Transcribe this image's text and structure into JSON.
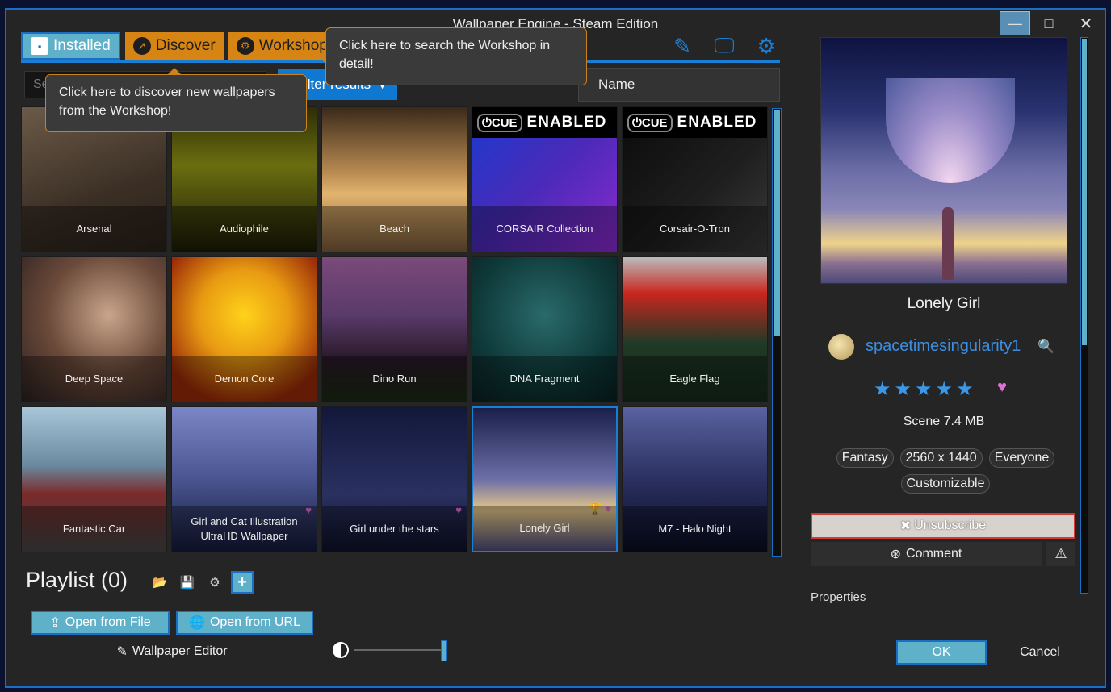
{
  "window": {
    "title": "Wallpaper Engine - Steam Edition",
    "controls": {
      "minimize": "—",
      "maximize": "□",
      "close": "✕"
    }
  },
  "tabs": [
    {
      "label": "Installed",
      "icon": "floppy-disk-icon",
      "glyph": "▪"
    },
    {
      "label": "Discover",
      "icon": "compass-icon",
      "glyph": "➚"
    },
    {
      "label": "Workshop",
      "icon": "steam-icon",
      "glyph": "⚙"
    }
  ],
  "toolbar_icons": [
    {
      "name": "editor-tools-icon",
      "glyph": "✎"
    },
    {
      "name": "display-icon",
      "glyph": "🖵"
    },
    {
      "name": "settings-gear-icon",
      "glyph": "⚙"
    }
  ],
  "tooltips": {
    "discover": "Click here to discover new wallpapers from the Workshop!",
    "workshop": "Click here to search the Workshop in detail!"
  },
  "search": {
    "placeholder": "Search",
    "filter_label": "Filter results",
    "filter_icon": "▼",
    "sort_value": "Name"
  },
  "wallpapers": [
    {
      "title": "Arsenal",
      "bg": "linear-gradient(160deg,#6b5a48,#3b2f25 60%,#2a2119)"
    },
    {
      "title": "Audiophile",
      "bg": "linear-gradient(180deg,#2d2e05,#6b6d10 40%,#1b1c06)"
    },
    {
      "title": "Beach",
      "bg": "linear-gradient(180deg,#3a2a1a,#b88a52 45%,#e2b46e 60%,#7a5a3a)"
    },
    {
      "title": "CORSAIR Collection",
      "bg": "linear-gradient(135deg,#1a3ad0,#4a2ab8 50%,#8a2ad0)",
      "cue": true
    },
    {
      "title": "Corsair-O-Tron",
      "bg": "linear-gradient(135deg,#0a0a0a,#1f1f1f 60%,#3a3a3a)",
      "cue": true
    },
    {
      "title": "Deep Space",
      "bg": "radial-gradient(circle at 60% 40%,#c9a58a,#6b4a3a 50%,#2a1f1f)"
    },
    {
      "title": "Demon Core",
      "bg": "radial-gradient(circle at 50% 40%,#ffd21a,#e89a12 40%,#9a2a08 80%)"
    },
    {
      "title": "Dino Run",
      "bg": "linear-gradient(180deg,#7a4a7a,#5a3a6a 40%,#2a1a2a 70%,#1a2a12)"
    },
    {
      "title": "DNA Fragment",
      "bg": "radial-gradient(circle at 50% 40%,#2a6a6a,#0f3a3a 60%,#0a1f1f)"
    },
    {
      "title": "Eagle Flag",
      "bg": "linear-gradient(180deg,#bbb 0%,#c8261e 25%,#1f3a26 60%,#152a1a)"
    },
    {
      "title": "Fantastic Car",
      "bg": "linear-gradient(180deg,#a8c6d8,#6a8aa0 40%,#7a2a2a 60%,#444)"
    },
    {
      "title": "Girl and Cat Illustration UltraHD Wallpaper",
      "bg": "linear-gradient(180deg,#7b86c6,#4a5490 50%,#141a3a)",
      "fav": true
    },
    {
      "title": "Girl under the stars",
      "bg": "linear-gradient(180deg,#12173a,#2a3160 60%,#0e1128)",
      "fav": true
    },
    {
      "title": "Lonely Girl",
      "bg": "linear-gradient(180deg,#1a1f4a,#6d6fa8 50%,#e6c888 72%,#4a4a7a)",
      "fav": true,
      "trophy": true,
      "selected": true
    },
    {
      "title": "M7 - Halo Night",
      "bg": "linear-gradient(180deg,#5a62a0,#2a3060 50%,#0a0d22)"
    }
  ],
  "playlist": {
    "title": "Playlist (0)",
    "buttons": [
      {
        "name": "load-playlist-button",
        "icon": "folder-icon",
        "glyph": "📂"
      },
      {
        "name": "save-playlist-button",
        "icon": "save-icon",
        "glyph": "💾"
      },
      {
        "name": "playlist-settings-button",
        "icon": "gears-icon",
        "glyph": "⚙"
      },
      {
        "name": "add-to-playlist-button",
        "icon": "plus-icon",
        "glyph": "+"
      }
    ]
  },
  "bottom_left": {
    "open_file": "Open from File",
    "open_file_glyph": "⇪",
    "open_url": "Open from URL",
    "open_url_glyph": "🌐",
    "editor": "Wallpaper Editor",
    "editor_glyph": "✎",
    "brightness_value": 1.0
  },
  "details": {
    "title": "Lonely Girl",
    "author": "spacetimesingularity1",
    "rating_stars": 5,
    "star_glyph": "★",
    "fav_glyph": "♥",
    "search_glyph": "🔍",
    "meta": "Scene  7.4 MB",
    "tags": [
      "Fantasy",
      "2560 x 1440",
      "Everyone",
      "Customizable"
    ],
    "unsubscribe": "Unsubscribe",
    "unsubscribe_glyph": "✖",
    "comment": "Comment",
    "comment_glyph": "⊛",
    "report_glyph": "⚠",
    "properties": "Properties"
  },
  "dialog": {
    "ok": "OK",
    "cancel": "Cancel"
  }
}
